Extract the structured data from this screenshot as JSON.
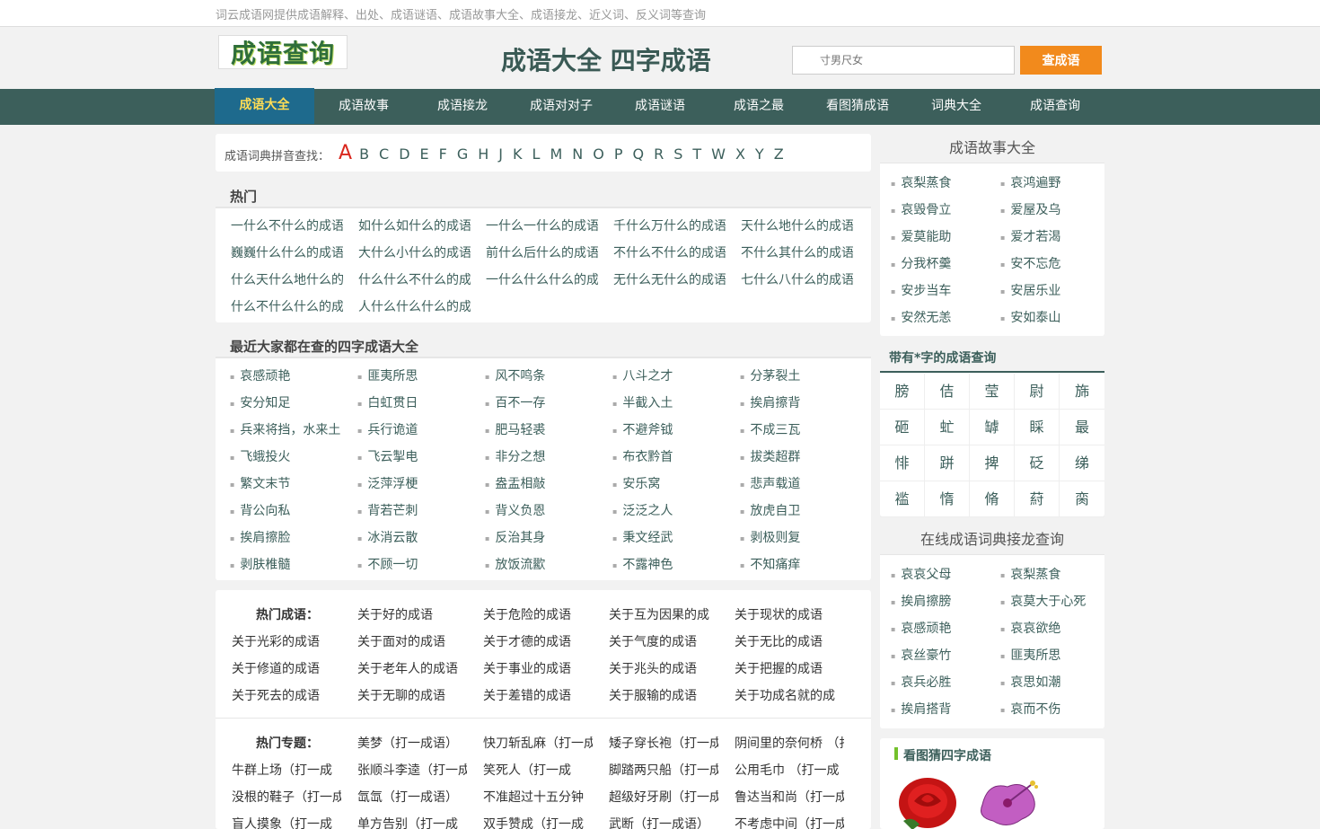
{
  "topbar": {
    "tagline": "词云成语网提供成语解释、出处、成语谜语、成语故事大全、成语接龙、近义词、反义词等查询"
  },
  "header": {
    "logo_text": "成语查询",
    "site_title": "成语大全 四字成语",
    "search_placeholder": "寸男尺女",
    "search_button": "查成语"
  },
  "nav": {
    "items": [
      "成语大全",
      "成语故事",
      "成语接龙",
      "成语对对子",
      "成语谜语",
      "成语之最",
      "看图猜成语",
      "词典大全",
      "成语查询"
    ]
  },
  "pinyin": {
    "label": "成语词典拼音查找：",
    "letters": [
      "A",
      "B",
      "C",
      "D",
      "E",
      "F",
      "G",
      "H",
      "J",
      "K",
      "L",
      "M",
      "N",
      "O",
      "P",
      "Q",
      "R",
      "S",
      "T",
      "W",
      "X",
      "Y",
      "Z"
    ]
  },
  "hot": {
    "title": "热门",
    "rows": [
      [
        "一什么不什么的成语",
        "如什么如什么的成语",
        "一什么一什么的成语",
        "千什么万什么的成语",
        "天什么地什么的成语"
      ],
      [
        "巍巍什么什么的成语",
        "大什么小什么的成语",
        "前什么后什么的成语",
        "不什么不什么的成语",
        "不什么其什么的成语"
      ],
      [
        "什么天什么地什么的",
        "什么什么不什么的成",
        "一什么什么什么的成",
        "无什么无什么的成语",
        "七什么八什么的成语"
      ],
      [
        "什么不什么什么的成",
        "人什么什么什么的成"
      ]
    ]
  },
  "recent": {
    "title": "最近大家都在查的四字成语大全",
    "rows": [
      [
        "哀感顽艳",
        "匪夷所思",
        "风不鸣条",
        "八斗之才",
        "分茅裂土"
      ],
      [
        "安分知足",
        "白虹贯日",
        "百不一存",
        "半截入土",
        "挨肩擦背"
      ],
      [
        "兵来将挡，水来土",
        "兵行诡道",
        "肥马轻裘",
        "不避斧钺",
        "不成三瓦"
      ],
      [
        "飞蛾投火",
        "飞云掣电",
        "非分之想",
        "布衣黔首",
        "拔类超群"
      ],
      [
        "繁文末节",
        "泛萍浮梗",
        "盎盂相敲",
        "安乐窝",
        "悲声载道"
      ],
      [
        "背公向私",
        "背若芒刺",
        "背义负恩",
        "泛泛之人",
        "放虎自卫"
      ],
      [
        "挨肩擦脸",
        "冰消云散",
        "反治其身",
        "秉文经武",
        "剥极则复"
      ],
      [
        "剥肤椎髓",
        "不顾一切",
        "放饭流歠",
        "不露神色",
        "不知痛痒"
      ]
    ]
  },
  "hotwords": {
    "idiom_label": "热门成语：",
    "idiom_rows": [
      [
        "关于好的成语",
        "关于危险的成语",
        "关于互为因果的成",
        "关于现状的成语"
      ],
      [
        "关于光彩的成语",
        "关于面对的成语",
        "关于才德的成语",
        "关于气度的成语",
        "关于无比的成语"
      ],
      [
        "关于修道的成语",
        "关于老年人的成语",
        "关于事业的成语",
        "关于兆头的成语",
        "关于把握的成语"
      ],
      [
        "关于死去的成语",
        "关于无聊的成语",
        "关于差错的成语",
        "关于服输的成语",
        "关于功成名就的成"
      ]
    ],
    "topic_label": "热门专题：",
    "topic_rows": [
      [
        "美梦（打一成语）",
        "快刀斩乱麻（打一成",
        "矮子穿长袍（打一成",
        "阴间里的奈何桥 （打"
      ],
      [
        "牛群上场（打一成",
        "张顺斗李逵（打一成",
        "笑死人（打一成",
        "脚踏两只船（打一成",
        "公用毛巾 （打一成"
      ],
      [
        "没根的鞋子（打一成",
        "氙氙（打一成语）",
        "不准超过十五分钟",
        "超级好牙刷（打一成",
        "鲁达当和尚（打一成"
      ],
      [
        "盲人摸象（打一成",
        "单方告别（打一成",
        "双手赞成（打一成",
        "武断（打一成语）",
        "不考虑中间（打一成"
      ]
    ]
  },
  "side_stories": {
    "title": "成语故事大全",
    "rows": [
      [
        "哀梨蒸食",
        "哀鸿遍野"
      ],
      [
        "哀毁骨立",
        "爱屋及乌"
      ],
      [
        "爱莫能助",
        "爱才若渴"
      ],
      [
        "分我杯羹",
        "安不忘危"
      ],
      [
        "安步当车",
        "安居乐业"
      ],
      [
        "安然无恙",
        "安如泰山"
      ]
    ]
  },
  "side_chars": {
    "title": "带有*字的成语查询",
    "rows": [
      [
        "膀",
        "佶",
        "莹",
        "尉",
        "旆"
      ],
      [
        "砸",
        "虻",
        "罅",
        "睬",
        "最"
      ],
      [
        "悱",
        "跰",
        "捭",
        "砭",
        "绨"
      ],
      [
        "褴",
        "惰",
        "脩",
        "葤",
        "脔"
      ]
    ]
  },
  "side_jielong": {
    "title": "在线成语词典接龙查询",
    "rows": [
      [
        "哀哀父母",
        "哀梨蒸食"
      ],
      [
        "挨肩擦膀",
        "哀莫大于心死"
      ],
      [
        "哀感顽艳",
        "哀哀欲绝"
      ],
      [
        "哀丝豪竹",
        "匪夷所思"
      ],
      [
        "哀兵必胜",
        "哀思如潮"
      ],
      [
        "挨肩搭背",
        "哀而不伤"
      ]
    ]
  },
  "side_guess": {
    "title": "看图猜四字成语"
  },
  "colors": {
    "nav": "#3c5f5b",
    "nav_active": "#1e6a8d",
    "accent": "#f28a1c",
    "link": "#3c5f5b",
    "pinyin_active": "#d9271e"
  }
}
